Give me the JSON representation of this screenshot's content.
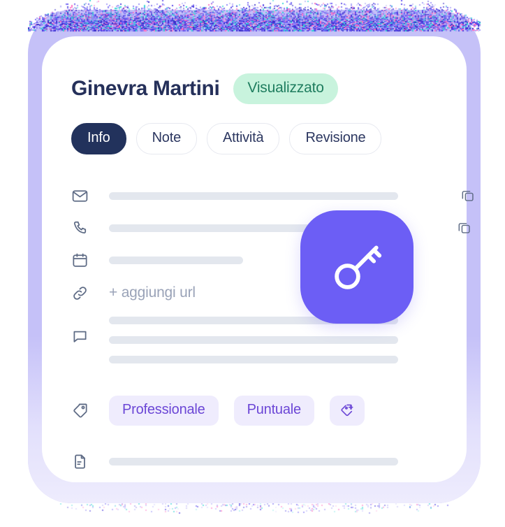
{
  "card": {
    "person_name": "Ginevra Martini",
    "status_badge": "Visualizzato",
    "tabs": [
      {
        "label": "Info",
        "active": true
      },
      {
        "label": "Note",
        "active": false
      },
      {
        "label": "Attività",
        "active": false
      },
      {
        "label": "Revisione",
        "active": false
      }
    ],
    "rows": {
      "email": {
        "icon": "envelope-icon",
        "value_placeholder": "",
        "copy_icon": "copy-icon"
      },
      "phone": {
        "icon": "phone-icon",
        "value_placeholder": "",
        "copy_icon": "copy-icon"
      },
      "calendar": {
        "icon": "calendar-icon",
        "value_placeholder": ""
      },
      "url": {
        "icon": "link-icon",
        "add_label": "+ aggiungi url"
      },
      "notes": {
        "icon": "chat-bubble-icon"
      },
      "tags": {
        "icon": "tag-icon",
        "chips": [
          "Professionale",
          "Puntuale"
        ],
        "add_icon": "tag-plus-icon"
      },
      "document": {
        "icon": "document-icon"
      }
    },
    "floating_badge": {
      "icon": "key-icon"
    }
  },
  "colors": {
    "frame": "#C5C1F8",
    "card": "#FFFFFF",
    "accent_purple": "#6C5EF5",
    "tag_purple_text": "#6B46D6",
    "tag_purple_bg": "#EFECFD",
    "navy": "#22325C",
    "badge_green_bg": "#C8F3DD",
    "badge_green_text": "#1F7D5F",
    "placeholder_bar": "#E3E7EE",
    "muted_text": "#9AA3B8",
    "icon_stroke": "#5E6B85"
  }
}
